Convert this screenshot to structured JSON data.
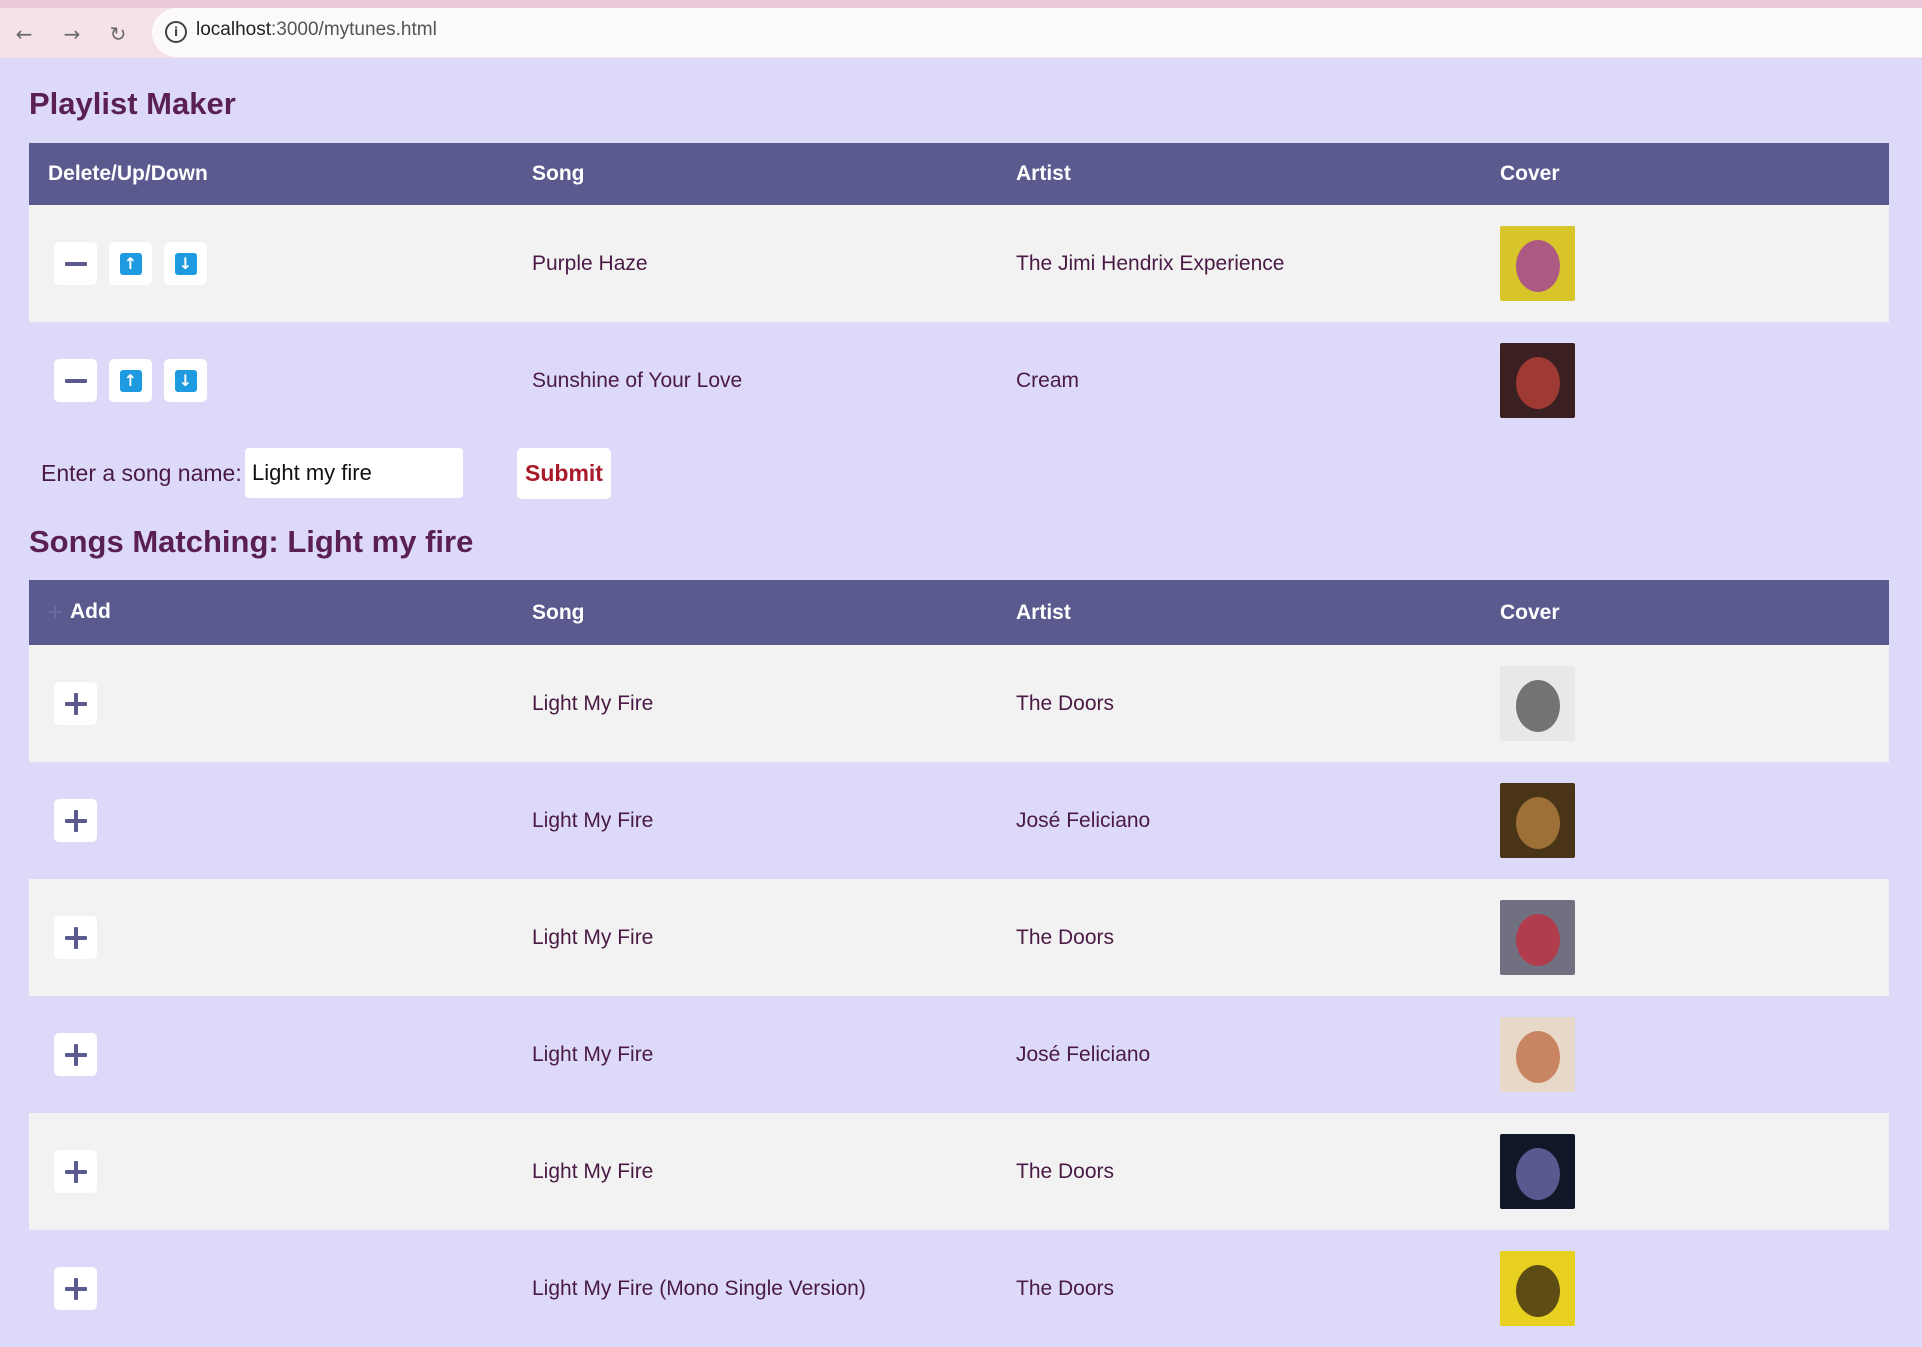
{
  "browser": {
    "url_host": "localhost",
    "url_path": ":3000/mytunes.html"
  },
  "page": {
    "title": "Playlist Maker",
    "playlist": {
      "headers": [
        "Delete/Up/Down",
        "Song",
        "Artist",
        "Cover"
      ],
      "rows": [
        {
          "song": "Purple Haze",
          "artist": "The Jimi Hendrix Experience",
          "cover_colors": [
            "#d8c52a",
            "#a33f9a"
          ]
        },
        {
          "song": "Sunshine of Your Love",
          "artist": "Cream",
          "cover_colors": [
            "#3a2020",
            "#b8403a"
          ]
        }
      ]
    },
    "search": {
      "label": "Enter a song name:",
      "value": "Light my fire",
      "submit_label": "Submit"
    },
    "results": {
      "title": "Songs Matching: Light my fire",
      "headers": [
        "Add",
        "Song",
        "Artist",
        "Cover"
      ],
      "rows": [
        {
          "song": "Light My Fire",
          "artist": "The Doors",
          "cover_colors": [
            "#e8e8e8",
            "#555555"
          ]
        },
        {
          "song": "Light My Fire",
          "artist": "José Feliciano",
          "cover_colors": [
            "#4a3418",
            "#b08040"
          ]
        },
        {
          "song": "Light My Fire",
          "artist": "The Doors",
          "cover_colors": [
            "#707080",
            "#c03040"
          ]
        },
        {
          "song": "Light My Fire",
          "artist": "José Feliciano",
          "cover_colors": [
            "#e8d8c8",
            "#c07048"
          ]
        },
        {
          "song": "Light My Fire",
          "artist": "The Doors",
          "cover_colors": [
            "#101828",
            "#6a6aa8"
          ]
        },
        {
          "song": "Light My Fire (Mono Single Version)",
          "artist": "The Doors",
          "cover_colors": [
            "#e8d020",
            "#3a2a10"
          ]
        }
      ]
    }
  },
  "colors": {
    "background": "#dcdaf8",
    "header": "#5b5a8f",
    "title": "#5a1f55",
    "arrow": "#1e9be0",
    "submit_text": "#a8192a"
  }
}
